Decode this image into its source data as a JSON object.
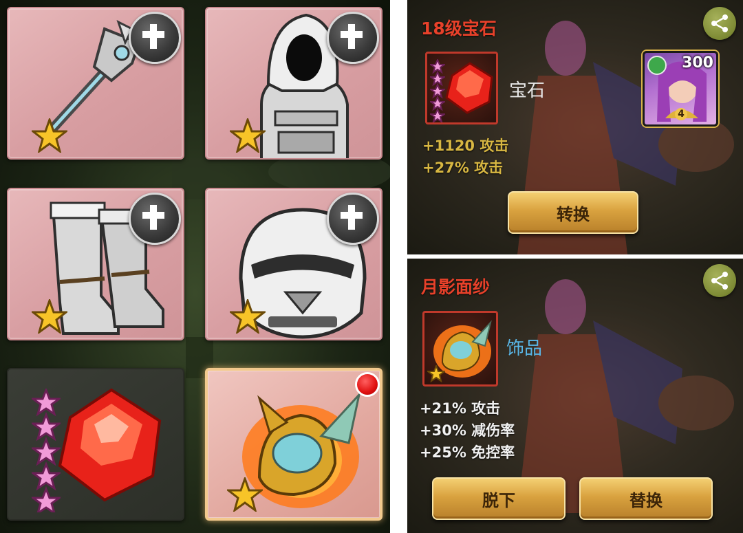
{
  "colors": {
    "slot_pink": "#d89ea2",
    "title_red": "#e8412a",
    "stat_gold": "#d8b742",
    "category_blue": "#59b7e8",
    "button_gold": "#d9a23f",
    "share_green": "#7d8a34"
  },
  "left_panel": {
    "slots": [
      {
        "item": "staff",
        "stars": 1,
        "action_icon": "plus-icon"
      },
      {
        "item": "hooded-armor",
        "stars": 1,
        "action_icon": "plus-icon"
      },
      {
        "item": "boots",
        "stars": 1,
        "action_icon": "plus-icon"
      },
      {
        "item": "helmet",
        "stars": 1,
        "action_icon": "plus-icon"
      },
      {
        "item": "red-gem",
        "stars": 5,
        "action_icon": ""
      },
      {
        "item": "moon-veil",
        "stars": 1,
        "action_icon": "",
        "notification": true
      }
    ]
  },
  "gem_panel": {
    "title": "18级宝石",
    "category": "宝石",
    "item_stars": 5,
    "stats": [
      "+1120 攻击",
      "+27% 攻击"
    ],
    "hero_count": "300",
    "hero_level": "4",
    "buttons": {
      "convert": "转换"
    }
  },
  "veil_panel": {
    "title": "月影面纱",
    "category": "饰品",
    "item_stars": 1,
    "stats": [
      "+21% 攻击",
      "+30% 减伤率",
      "+25% 免控率"
    ],
    "buttons": {
      "unequip": "脱下",
      "replace": "替换"
    }
  }
}
